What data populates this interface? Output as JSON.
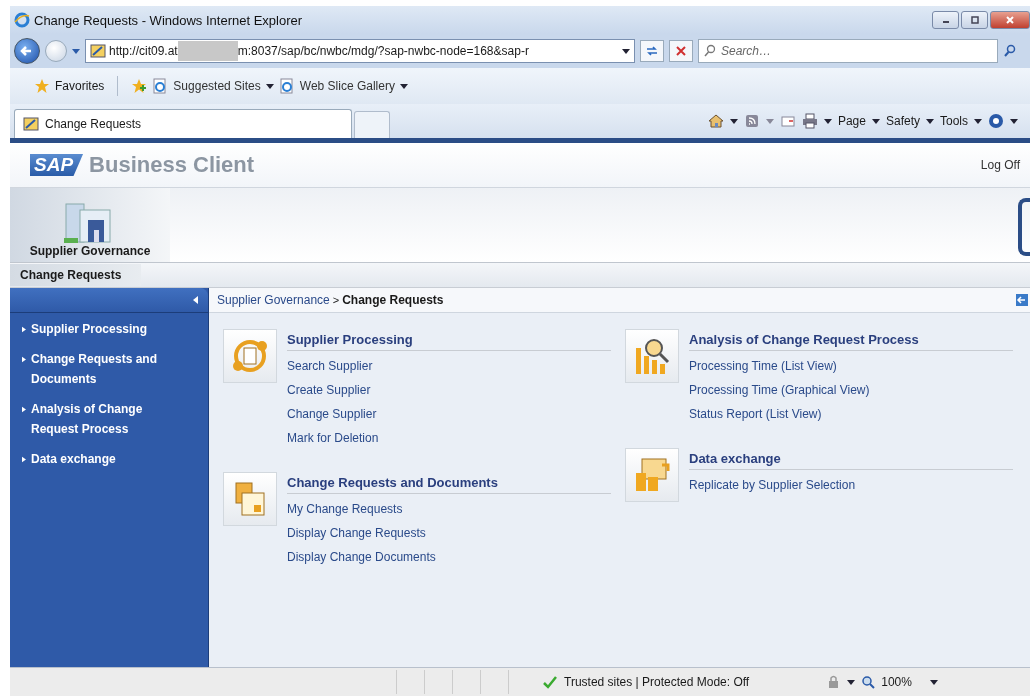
{
  "window": {
    "title": "Change Requests - Windows Internet Explorer"
  },
  "address_bar": {
    "url_start": "http://cit09.at",
    "url_end": "m:8037/sap/bc/nwbc/mdg/?sap-nwbc-node=168&sap-r"
  },
  "search": {
    "placeholder": "Search…"
  },
  "favorites_bar": {
    "favorites": "Favorites",
    "links": [
      {
        "label": "Suggested Sites"
      },
      {
        "label": "Web Slice Gallery"
      }
    ]
  },
  "tabs": [
    {
      "label": "Change Requests",
      "selected": true
    }
  ],
  "command_bar": [
    "Page",
    "Safety",
    "Tools"
  ],
  "sap_header": {
    "logo": "SAP",
    "product": "Business Client",
    "log_off": "Log Off"
  },
  "work_centers": [
    {
      "label": "Supplier Governance",
      "selected": true
    }
  ],
  "sub_nav": [
    {
      "label": "Change Requests",
      "selected": true
    }
  ],
  "breadcrumb": {
    "parent": "Supplier Governance",
    "separator": ">",
    "current": "Change Requests"
  },
  "sidebar": {
    "items": [
      {
        "label": "Supplier Processing"
      },
      {
        "label": "Change Requests and Documents"
      },
      {
        "label": "Analysis of Change Request Process"
      },
      {
        "label": "Data exchange"
      }
    ]
  },
  "columns": [
    [
      {
        "title": "Supplier Processing",
        "kind": "cycle",
        "links": [
          "Search Supplier",
          "Create Supplier",
          "Change Supplier",
          "Mark for Deletion"
        ]
      },
      {
        "title": "Change Requests and Documents",
        "kind": "documents",
        "links": [
          "My Change Requests",
          "Display Change Requests",
          "Display Change Documents"
        ]
      }
    ],
    [
      {
        "title": "Analysis of Change Request Process",
        "kind": "analysis",
        "links": [
          "Processing Time (List View)",
          "Processing Time (Graphical View)",
          "Status Report (List View)"
        ]
      },
      {
        "title": "Data exchange",
        "kind": "exchange",
        "links": [
          "Replicate by Supplier Selection"
        ]
      }
    ]
  ],
  "status_bar": {
    "zone": "Trusted sites | Protected Mode: Off",
    "zoom": "100%"
  }
}
